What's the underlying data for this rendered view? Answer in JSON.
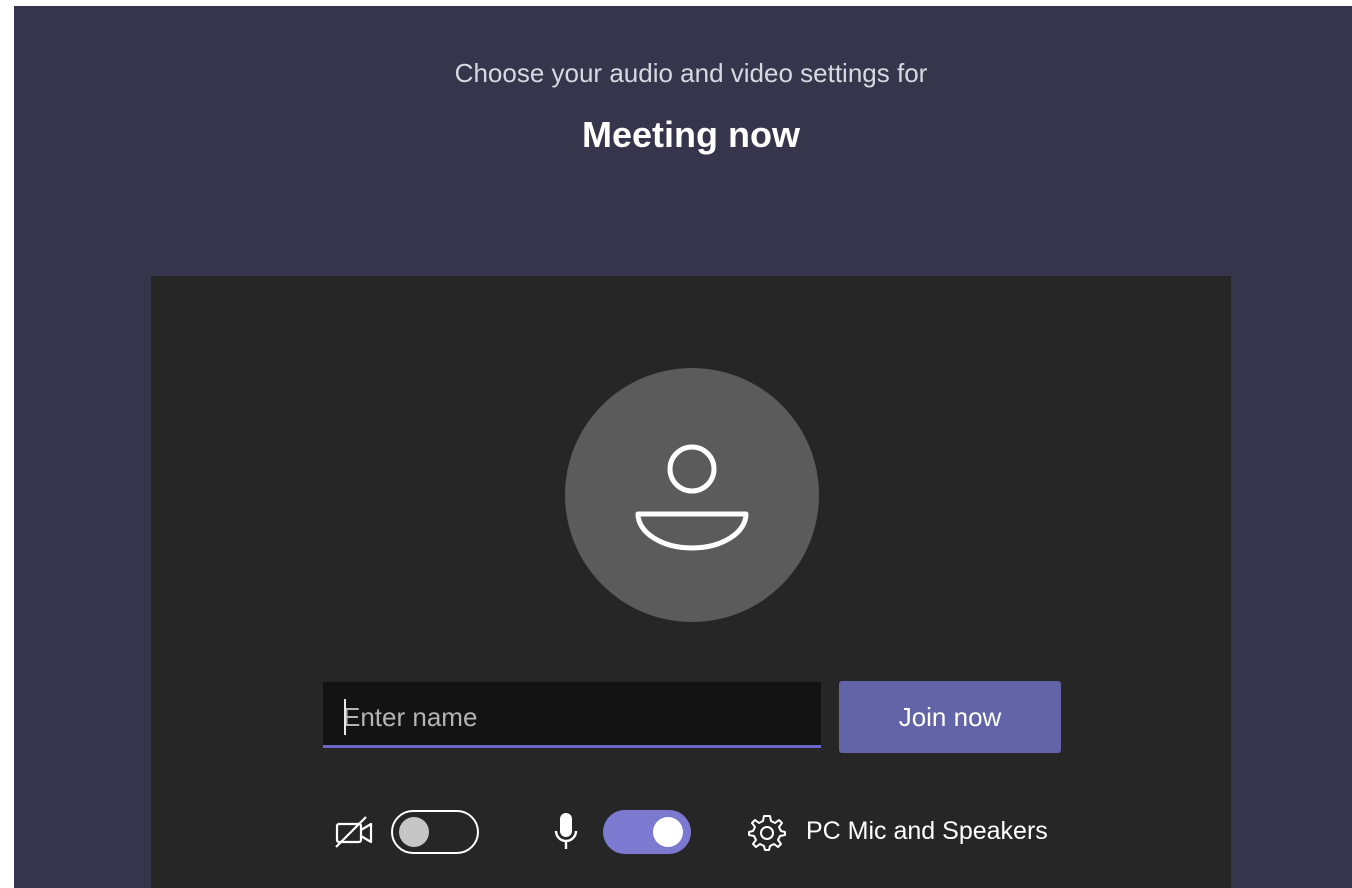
{
  "header": {
    "subtitle": "Choose your audio and video settings for",
    "meeting_title": "Meeting now"
  },
  "join_form": {
    "name_input": {
      "value": "",
      "placeholder": "Enter name"
    },
    "join_button_label": "Join now"
  },
  "controls": {
    "camera": {
      "icon": "camera-off-icon",
      "toggle_state": "off"
    },
    "microphone": {
      "icon": "microphone-icon",
      "toggle_state": "on"
    },
    "device_settings": {
      "icon": "gear-icon",
      "label": "PC Mic and Speakers"
    }
  },
  "colors": {
    "page_background": "#37354b",
    "preview_background": "#262626",
    "accent": "#6264a7",
    "toggle_on": "#7b7ad0",
    "avatar_circle": "#5c5b5c"
  }
}
